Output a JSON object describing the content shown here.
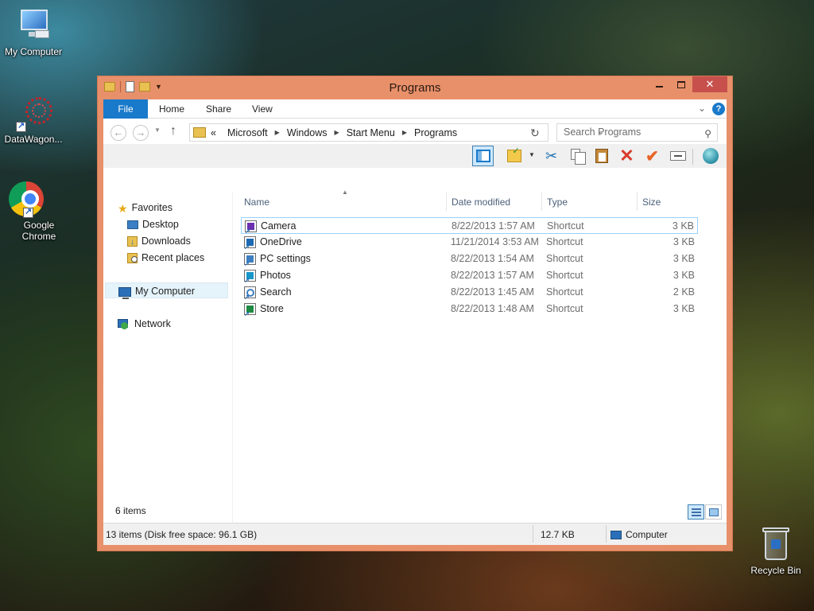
{
  "desktop": {
    "icons": [
      {
        "label": "My Computer",
        "icon": "computer-icon"
      },
      {
        "label": "DataWagon...",
        "icon": "datawagon-icon"
      },
      {
        "label": "Google Chrome",
        "icon": "chrome-icon"
      },
      {
        "label": "Recycle Bin",
        "icon": "recycle-bin-icon"
      }
    ]
  },
  "window": {
    "title": "Programs",
    "accent_color": "#e8906a",
    "ribbon_tabs": [
      "File",
      "Home",
      "Share",
      "View"
    ],
    "address": {
      "overflow": "«",
      "crumbs": [
        "Microsoft",
        "Windows",
        "Start Menu",
        "Programs"
      ]
    },
    "search": {
      "placeholder": "Search Programs"
    },
    "toolbar": {
      "icons": [
        "preview-pane-icon",
        "folder-options-icon",
        "cut-icon",
        "copy-icon",
        "paste-icon",
        "delete-icon",
        "select-icon",
        "rename-icon",
        "globe-icon"
      ]
    },
    "nav": {
      "favorites": "Favorites",
      "favorites_items": [
        "Desktop",
        "Downloads",
        "Recent places"
      ],
      "my_computer": "My Computer",
      "network": "Network"
    },
    "columns": {
      "name": "Name",
      "date": "Date modified",
      "type": "Type",
      "size": "Size"
    },
    "files": [
      {
        "name": "Camera",
        "date": "8/22/2013 1:57 AM",
        "type": "Shortcut",
        "size": "3 KB",
        "icon": "camera-shortcut-icon"
      },
      {
        "name": "OneDrive",
        "date": "11/21/2014 3:53 AM",
        "type": "Shortcut",
        "size": "3 KB",
        "icon": "onedrive-shortcut-icon"
      },
      {
        "name": "PC settings",
        "date": "8/22/2013 1:54 AM",
        "type": "Shortcut",
        "size": "3 KB",
        "icon": "pc-settings-shortcut-icon"
      },
      {
        "name": "Photos",
        "date": "8/22/2013 1:57 AM",
        "type": "Shortcut",
        "size": "3 KB",
        "icon": "photos-shortcut-icon"
      },
      {
        "name": "Search",
        "date": "8/22/2013 1:45 AM",
        "type": "Shortcut",
        "size": "2 KB",
        "icon": "search-shortcut-icon"
      },
      {
        "name": "Store",
        "date": "8/22/2013 1:48 AM",
        "type": "Shortcut",
        "size": "3 KB",
        "icon": "store-shortcut-icon"
      }
    ],
    "item_count": "6 items",
    "status": {
      "items": "13 items (Disk free space: 96.1 GB)",
      "size": "12.7 KB",
      "location": "Computer"
    }
  }
}
